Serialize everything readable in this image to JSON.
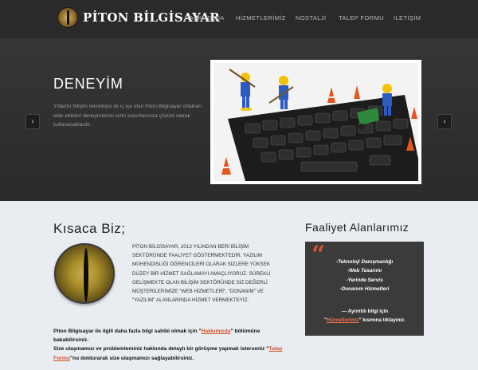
{
  "header": {
    "logo_text": "PİTON BİLGİSAYAR",
    "nav": [
      "HAKKIMIZDA",
      "HİZMETLERİMİZ",
      "NOSTALJİ",
      "TALEP FORMU",
      "İLETİŞİM"
    ]
  },
  "hero": {
    "title": "DENEYİM",
    "description": "Yıllardır bilişim teknolojisi ile iç içe olan Piton Bilgisayar ortakları elde ettikleri deneyimlerini sizin sorunlarınıza çözüm olarak kullanacaklardır.",
    "prev_icon": "chevron-left-icon",
    "next_icon": "chevron-right-icon"
  },
  "about": {
    "title": "Kısaca Biz;",
    "text": "PİTON BİLGİSAYAR, 2013 YILINDAN BERİ BİLİŞİM SEKTÖRÜNDE FAALİYET GÖSTERMEKTEDİR. YAZILIM MÜHENDİSLİĞİ ÖĞRENCİLERİ OLARAK SİZLERE YÜKSEK DÜZEY BİR HİZMET SAĞLAMAYI AMAÇLIYORUZ. SÜREKLİ GELİŞMEKTE OLAN BİLİŞİM SEKTÖRÜNDE SİZ DEĞERLİ MÜŞTERİLERİMİZE \"WEB HİZMETLERİ\", \"DONANIM\" VE \"YAZILIM\" ALANLARINDA HİZMET VERMEKTEYİZ.",
    "line1_pre": "Piton Bilgisayar ile ilgili daha fazla bilgi sahibi olmak için \"",
    "line1_link": "Hakkımızda",
    "line1_post": "\" bölümüne bakabilirsiniz.",
    "line2_pre": "Size ulaşmamızı ve problemleminiz hakkında detaylı bir görüşme yapmak isterseniz \"",
    "line2_link": "Talep Formu",
    "line2_post": "\"nu doldurarak size ulaşmamızı sağlayabilirsiniz."
  },
  "services": {
    "title": "Faaliyet Alanlarımız",
    "items": [
      "-Teknoloji Danışmanlığı",
      "-Web Tasarımı",
      "-Yerinde Servis",
      "-Donanım Hizmetleri"
    ],
    "note_pre": "— Ayrıntılı bilgi için",
    "note_link": "Hizmetlerimiz",
    "note_post": "\" kısmına tıklayınız.",
    "accent": "#d9532a"
  }
}
